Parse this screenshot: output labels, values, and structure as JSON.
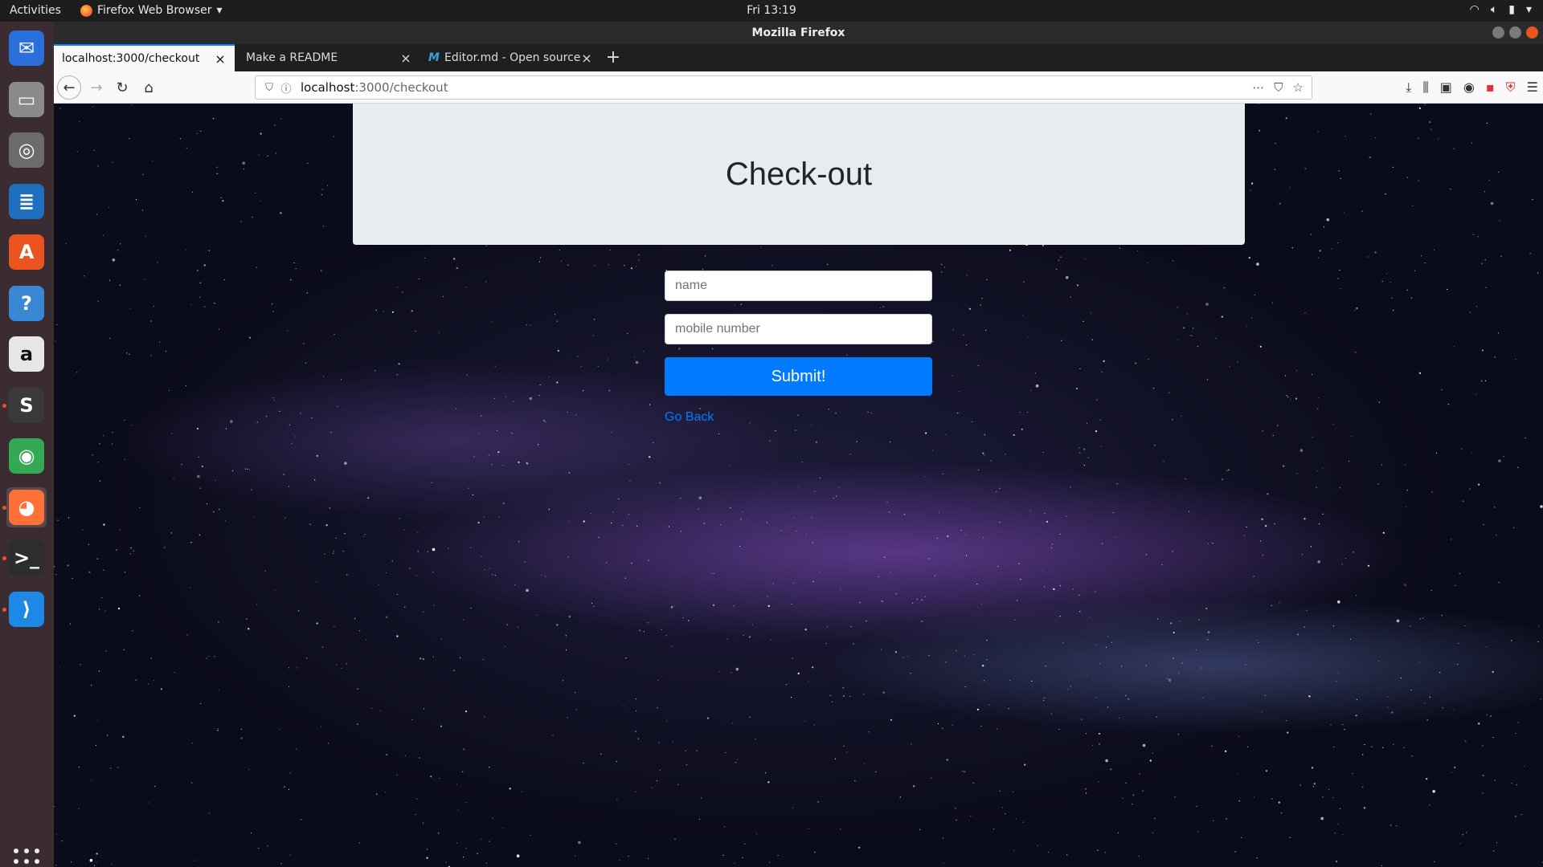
{
  "system": {
    "activities_label": "Activities",
    "app_menu_label": "Firefox Web Browser",
    "clock": "Fri 13:19"
  },
  "dock": {
    "items": [
      {
        "name": "thunderbird",
        "glyph": "✉",
        "color": "#2a6fdb"
      },
      {
        "name": "files",
        "glyph": "▭",
        "color": "#8a8a8a"
      },
      {
        "name": "rhythmbox",
        "glyph": "◎",
        "color": "#6b6b6b"
      },
      {
        "name": "libreoffice-writer",
        "glyph": "≣",
        "color": "#1f6fbf"
      },
      {
        "name": "software-center",
        "glyph": "A",
        "color": "#e95420"
      },
      {
        "name": "help",
        "glyph": "?",
        "color": "#3a87d6"
      },
      {
        "name": "amazon",
        "glyph": "a",
        "color": "#e6e6e6"
      },
      {
        "name": "sublime-text",
        "glyph": "S",
        "color": "#3a3a3a"
      },
      {
        "name": "chrome",
        "glyph": "◉",
        "color": "#34a853"
      },
      {
        "name": "firefox",
        "glyph": "◕",
        "color": "#ff7139"
      },
      {
        "name": "terminal",
        "glyph": ">_",
        "color": "#2d2d2d"
      },
      {
        "name": "vscode",
        "glyph": "⟩",
        "color": "#1e88e5"
      }
    ]
  },
  "browser": {
    "window_title": "Mozilla Firefox",
    "tabs": [
      {
        "label": "localhost:3000/checkout",
        "active": true
      },
      {
        "label": "Make a README",
        "active": false
      },
      {
        "label": "Editor.md - Open source",
        "active": false,
        "favicon": "M"
      }
    ],
    "url_host": "localhost",
    "url_path": ":3000/checkout",
    "url_actions": [
      "⋯",
      "⛉",
      "☆"
    ],
    "toolbar_icons": [
      "⤓",
      "⫼",
      "▣",
      "◉",
      "▪",
      "⛨",
      "☰"
    ]
  },
  "page": {
    "heading": "Check-out",
    "name_placeholder": "name",
    "mobile_placeholder": "mobile number",
    "submit_label": "Submit!",
    "go_back_label": "Go Back"
  },
  "colors": {
    "primary": "#007bff",
    "jumbotron_bg": "#e9ecef",
    "ubuntu_orange": "#e95420"
  }
}
